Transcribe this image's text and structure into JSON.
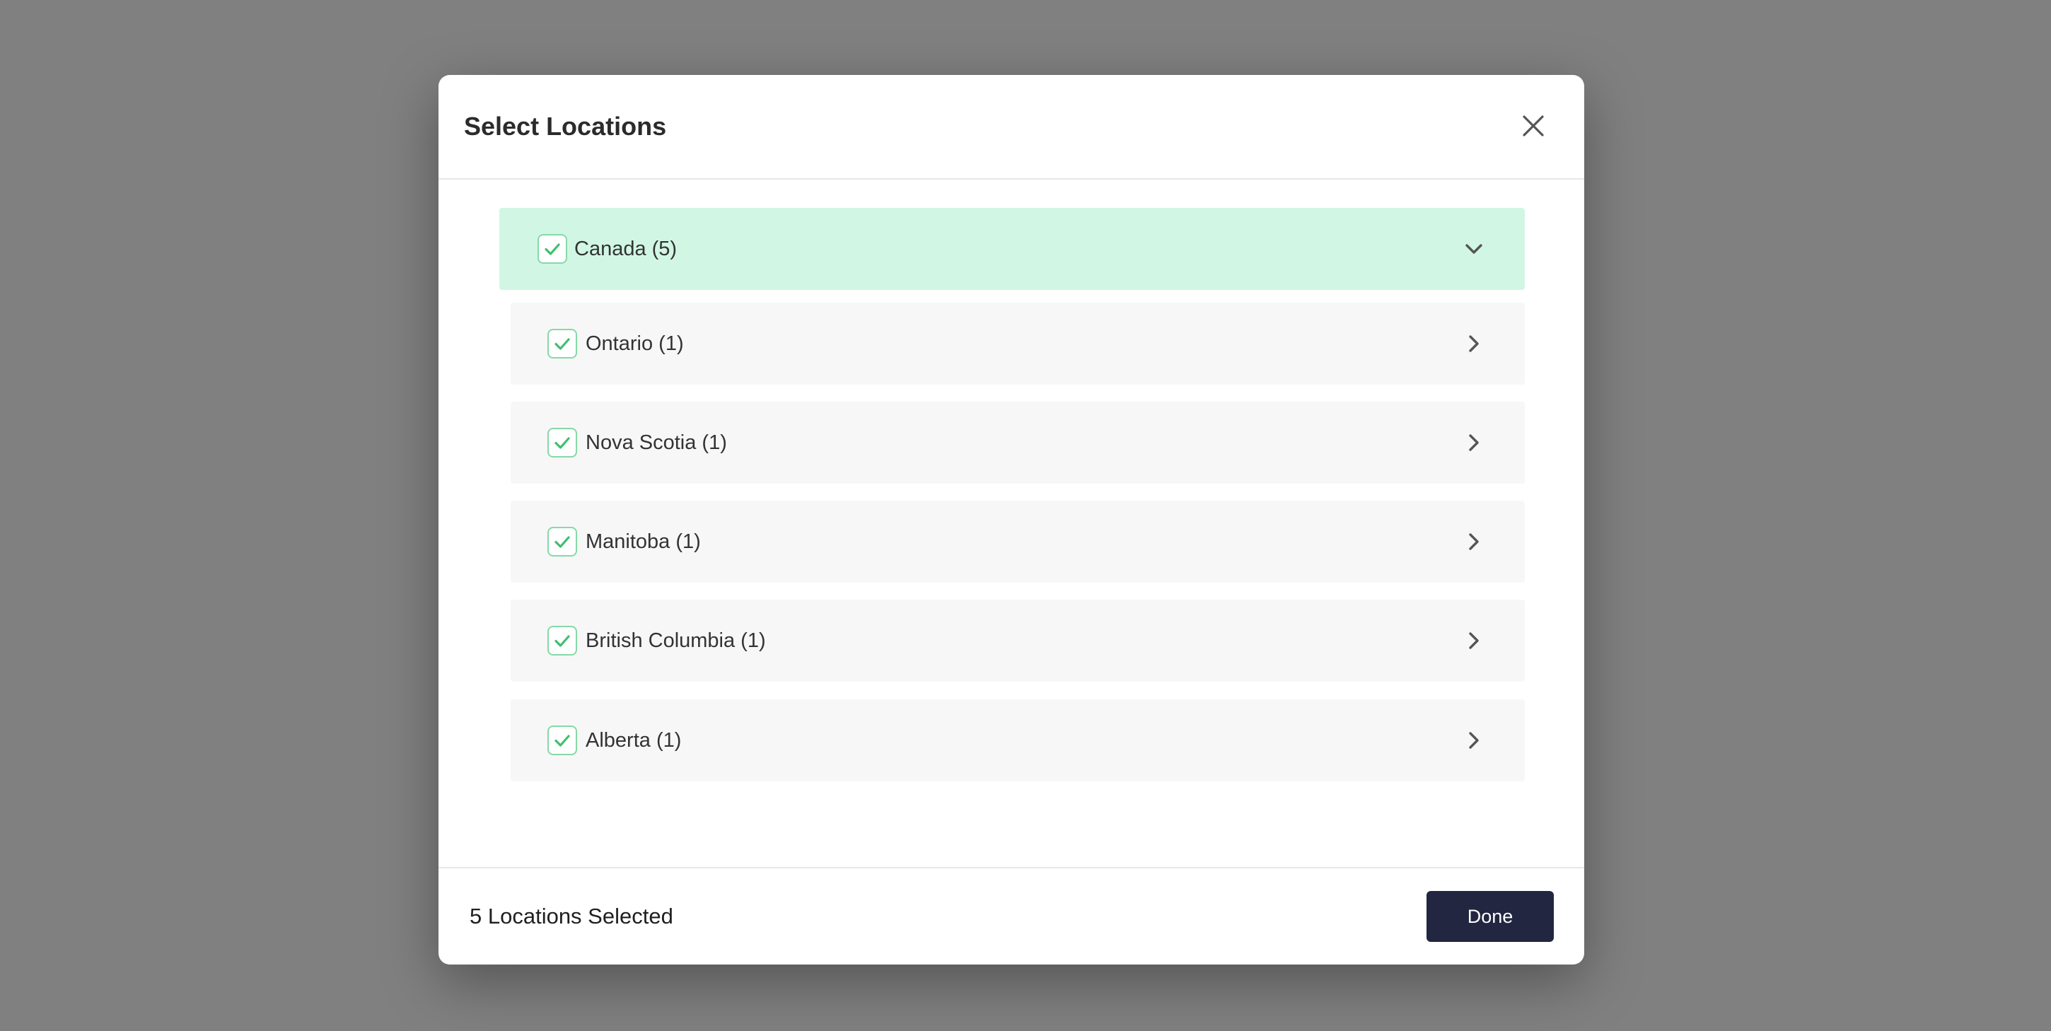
{
  "modal": {
    "title": "Select Locations",
    "close_icon": "close-icon"
  },
  "tree": {
    "parent": {
      "label": "Canada (5)",
      "checked": true,
      "expanded": true,
      "icon": "chevron-down-icon"
    },
    "children": [
      {
        "label": "Ontario (1)",
        "checked": true,
        "icon": "chevron-right-icon"
      },
      {
        "label": "Nova Scotia (1)",
        "checked": true,
        "icon": "chevron-right-icon"
      },
      {
        "label": "Manitoba (1)",
        "checked": true,
        "icon": "chevron-right-icon"
      },
      {
        "label": "British Columbia (1)",
        "checked": true,
        "icon": "chevron-right-icon"
      },
      {
        "label": "Alberta (1)",
        "checked": true,
        "icon": "chevron-right-icon"
      }
    ]
  },
  "footer": {
    "selected_text": "5 Locations Selected",
    "done_label": "Done"
  },
  "colors": {
    "backdrop": "#808080",
    "parent_row_bg": "#d1f7e4",
    "child_row_bg": "#f7f7f7",
    "check_color": "#3fbf6e",
    "done_bg": "#222640"
  }
}
